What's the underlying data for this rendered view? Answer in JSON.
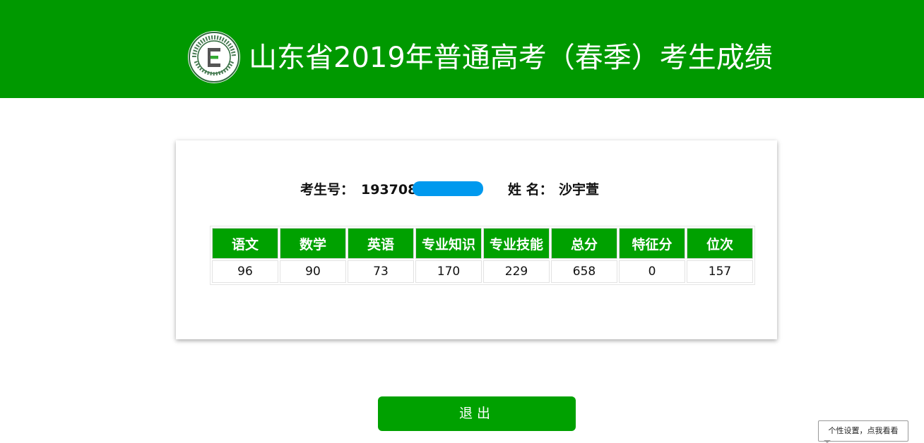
{
  "header": {
    "title": "山东省2019年普通高考（春季）考生成绩",
    "logo_letter": "E",
    "logo_icon": "exam-institute-seal-icon",
    "background_color": "#009900"
  },
  "candidate": {
    "id_label": "考生号：",
    "id_value": "193708",
    "name_label": "姓 名：",
    "name_value": "沙宇萱"
  },
  "scores": {
    "headers": [
      "语文",
      "数学",
      "英语",
      "专业知识",
      "专业技能",
      "总分",
      "特征分",
      "位次"
    ],
    "values": [
      "96",
      "90",
      "73",
      "170",
      "229",
      "658",
      "0",
      "157"
    ]
  },
  "actions": {
    "exit_label": "退出"
  },
  "tooltip": {
    "text": "个性设置，点我看看"
  },
  "colors": {
    "brand_green": "#009900",
    "table_header_green": "#00a100",
    "redaction_blue": "#0099ee"
  }
}
